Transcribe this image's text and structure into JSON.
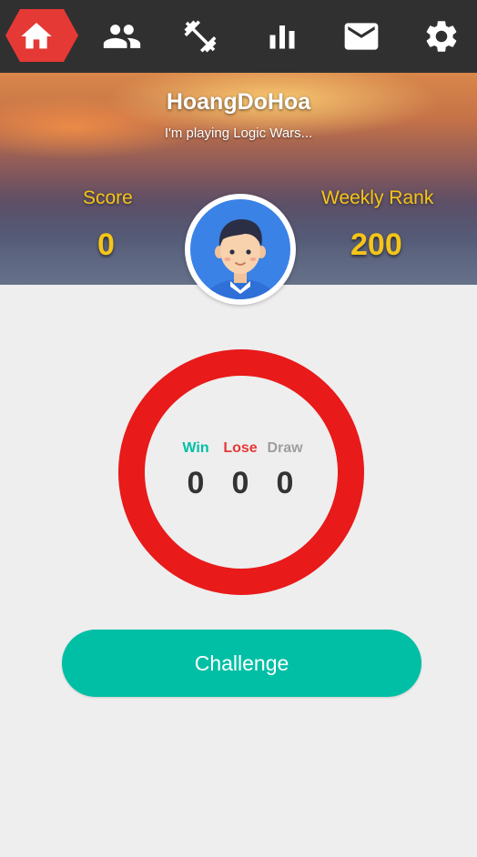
{
  "nav": {
    "items": [
      {
        "icon": "home-icon",
        "active": true
      },
      {
        "icon": "friends-icon",
        "active": false
      },
      {
        "icon": "dumbbell-icon",
        "active": false
      },
      {
        "icon": "bar-chart-icon",
        "active": false
      },
      {
        "icon": "mail-icon",
        "active": false
      },
      {
        "icon": "gear-icon",
        "active": false
      }
    ],
    "active_color": "#e53935"
  },
  "profile": {
    "username": "HoangDoHoa",
    "status": "I'm playing Logic Wars...",
    "score_label": "Score",
    "score_value": "0",
    "rank_label": "Weekly Rank",
    "rank_value": "200",
    "avatar_icon": "boy-avatar-icon"
  },
  "record": {
    "win_label": "Win",
    "lose_label": "Lose",
    "draw_label": "Draw",
    "win_value": "0",
    "lose_value": "0",
    "draw_value": "0",
    "win_color": "#00bfa5",
    "lose_color": "#e53935",
    "draw_color": "#9e9e9e",
    "ring_color": "#e81a1a"
  },
  "actions": {
    "challenge_label": "Challenge",
    "challenge_color": "#00bfa5"
  }
}
